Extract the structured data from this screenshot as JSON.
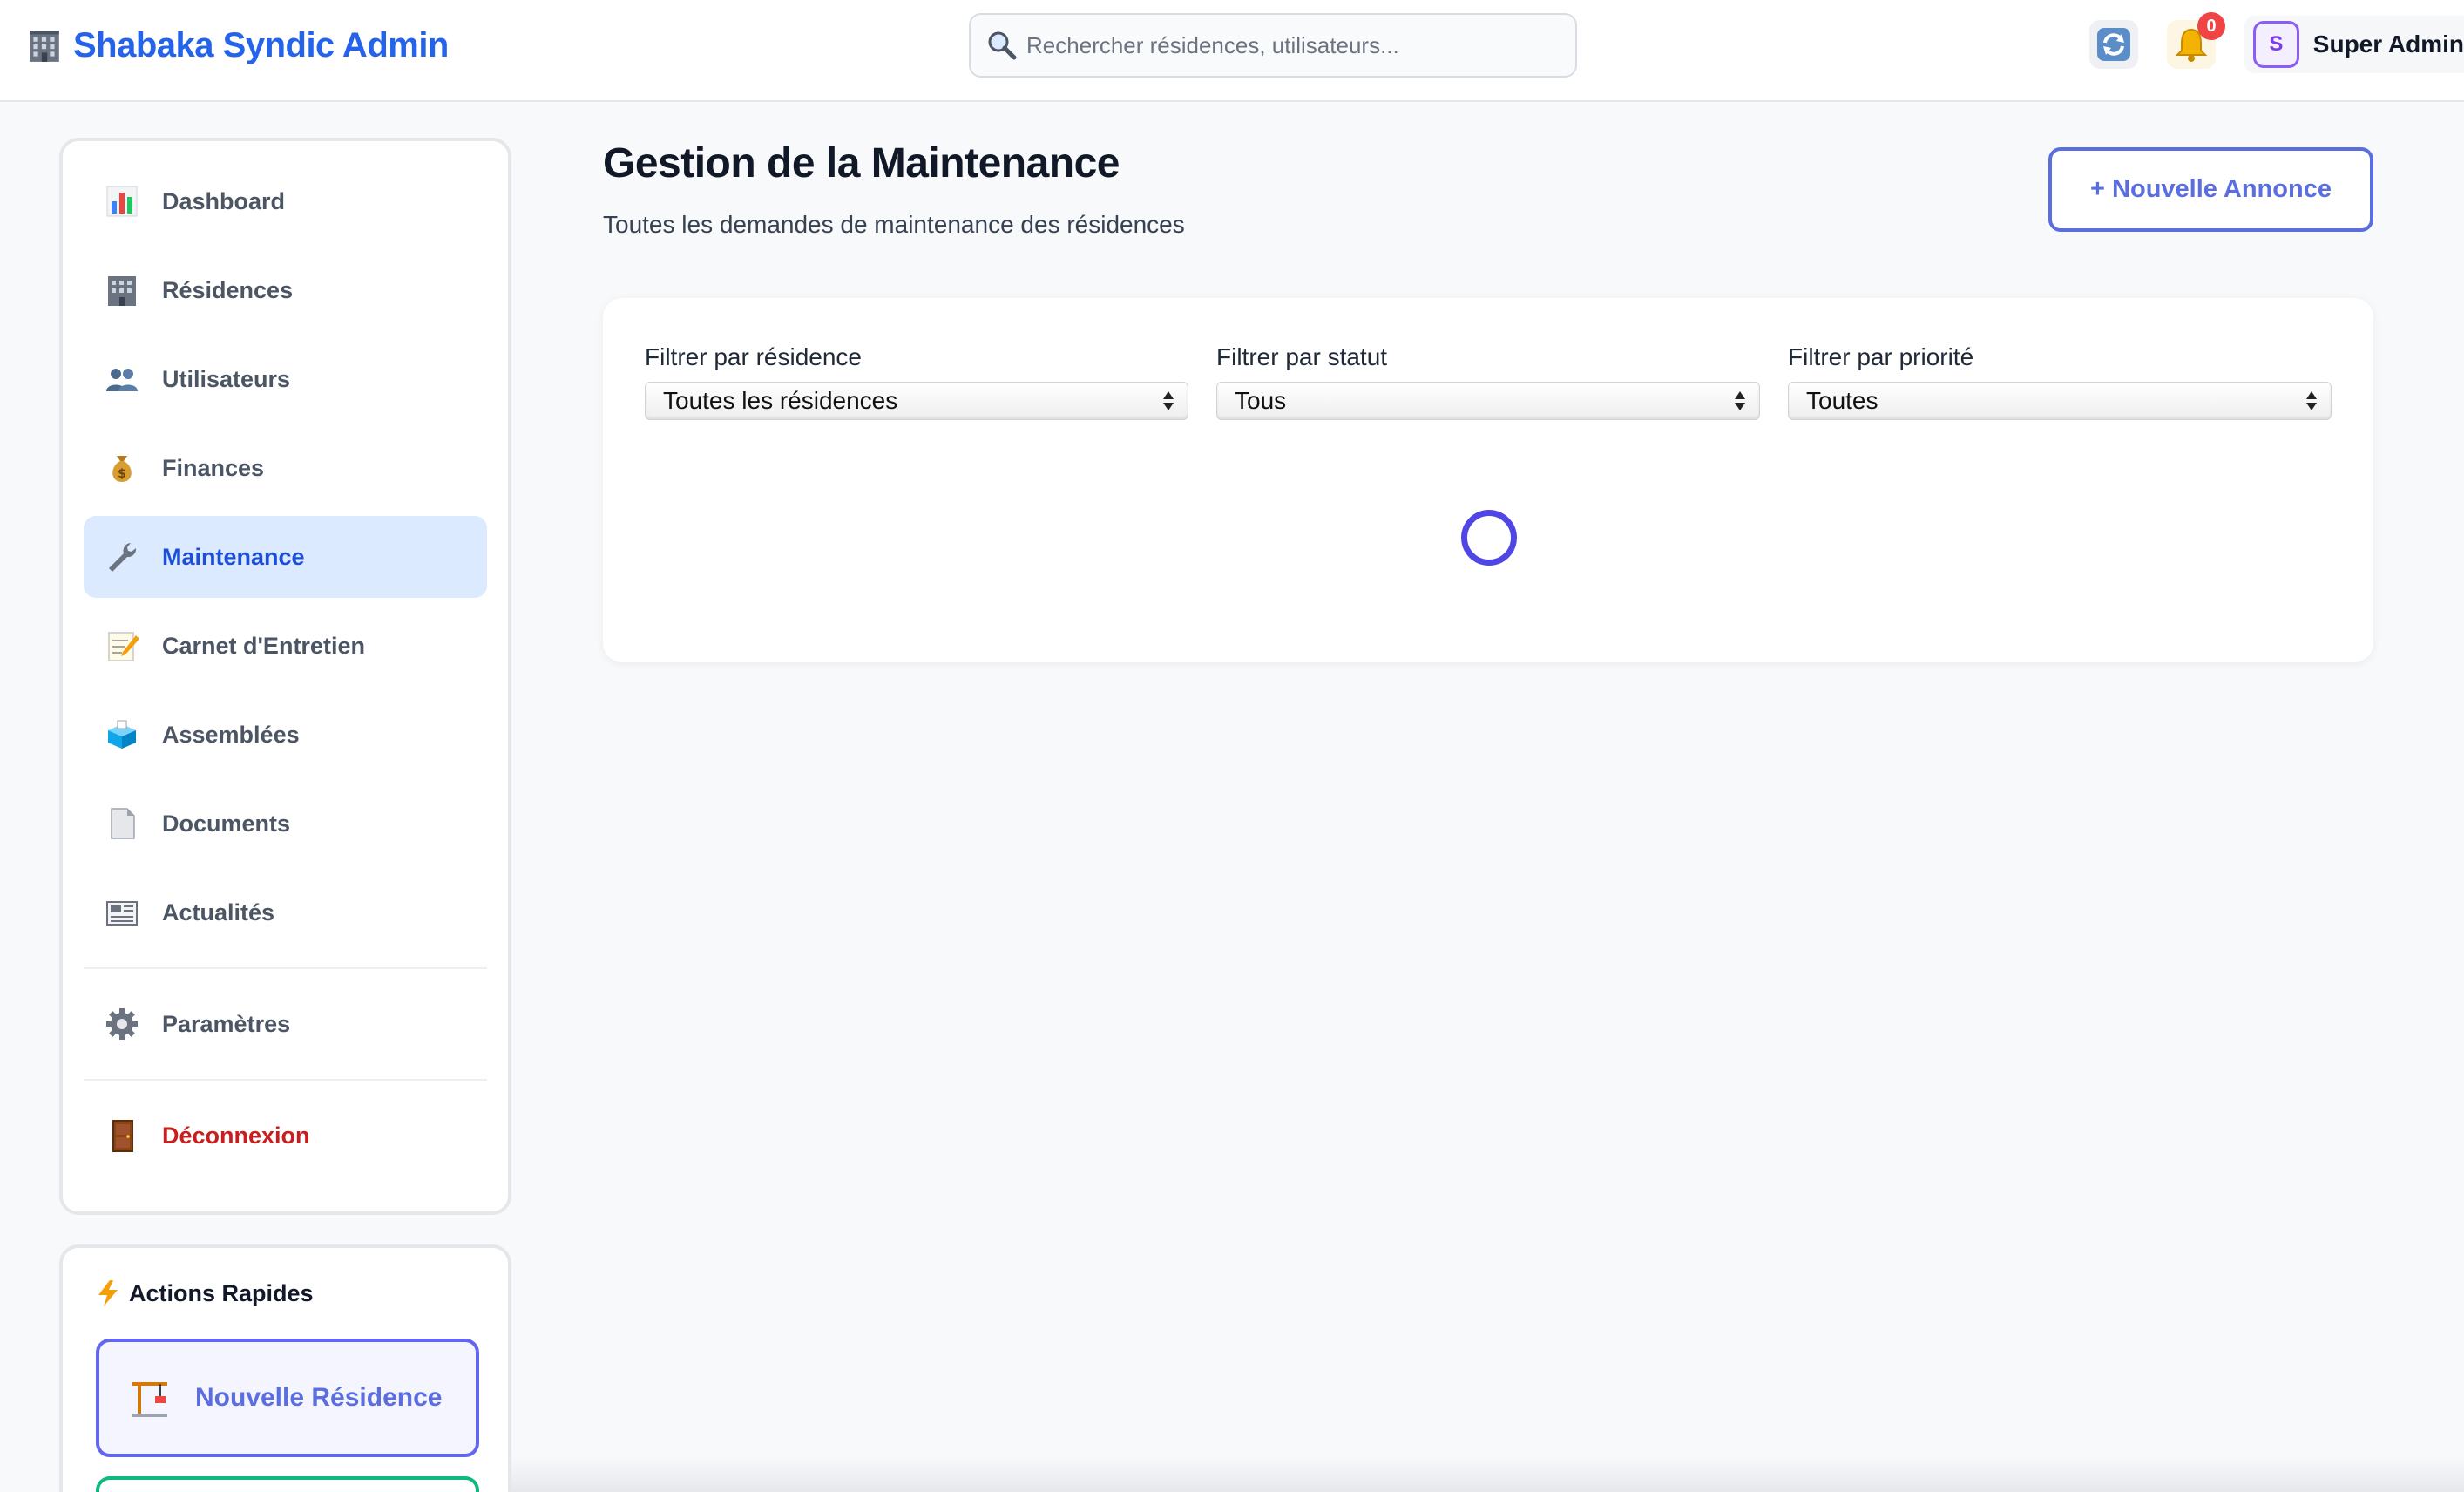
{
  "app": {
    "title": "Shabaka Syndic Admin"
  },
  "header": {
    "search_placeholder": "Rechercher résidences, utilisateurs...",
    "notification_count": "0",
    "user_initial": "S",
    "user_name": "Super Admin"
  },
  "sidebar": {
    "items": [
      {
        "label": "Dashboard",
        "icon": "bar-chart-icon"
      },
      {
        "label": "Résidences",
        "icon": "building-icon"
      },
      {
        "label": "Utilisateurs",
        "icon": "users-icon"
      },
      {
        "label": "Finances",
        "icon": "money-bag-icon"
      },
      {
        "label": "Maintenance",
        "icon": "wrench-icon",
        "active": true
      },
      {
        "label": "Carnet d'Entretien",
        "icon": "memo-icon"
      },
      {
        "label": "Assemblées",
        "icon": "ballot-box-icon"
      },
      {
        "label": "Documents",
        "icon": "document-icon"
      },
      {
        "label": "Actualités",
        "icon": "newspaper-icon"
      }
    ],
    "settings": {
      "label": "Paramètres",
      "icon": "gear-icon"
    },
    "logout": {
      "label": "Déconnexion",
      "icon": "door-icon"
    }
  },
  "quick_actions": {
    "title": "Actions Rapides",
    "new_residence": "Nouvelle Résidence"
  },
  "main": {
    "title": "Gestion de la Maintenance",
    "subtitle": "Toutes les demandes de maintenance des résidences",
    "new_button": "+ Nouvelle Annonce",
    "filters": {
      "residence": {
        "label": "Filtrer par résidence",
        "value": "Toutes les résidences"
      },
      "status": {
        "label": "Filtrer par statut",
        "value": "Tous"
      },
      "priority": {
        "label": "Filtrer par priorité",
        "value": "Toutes"
      }
    }
  },
  "colors": {
    "brand": "#2563eb",
    "active_bg": "#dbeafe",
    "accent": "#5b6ee0",
    "danger": "#c81e1e",
    "spinner": "#4f46e5"
  }
}
